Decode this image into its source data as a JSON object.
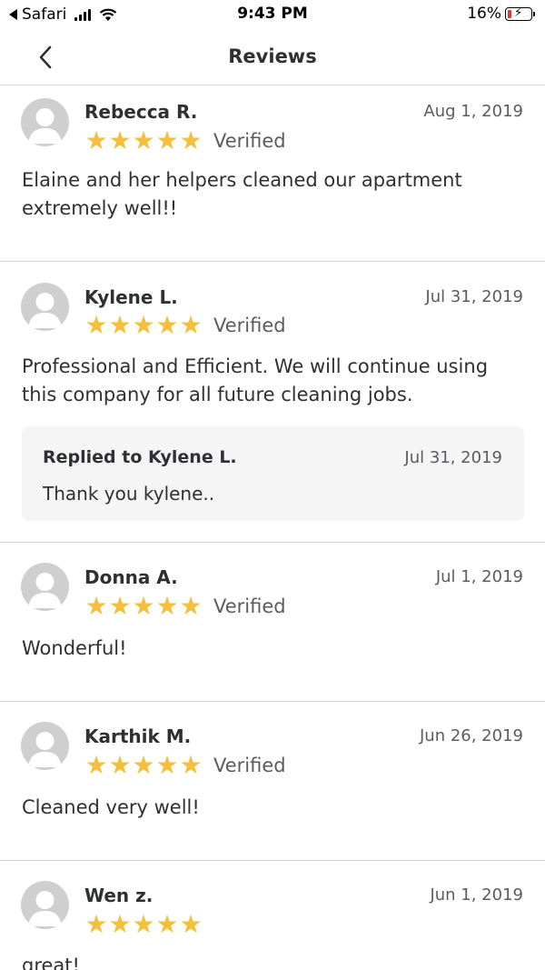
{
  "status_bar": {
    "back_app": "Safari",
    "time": "9:43 PM",
    "battery_percent": "16%",
    "battery_level": 0.16,
    "battery_color": "#e7343b"
  },
  "nav": {
    "title": "Reviews",
    "back_icon": "chevron-left-icon"
  },
  "colors": {
    "star": "#f4bf3b",
    "text": "#2f3033",
    "muted": "#5a5c60",
    "reply_bg": "#f5f5f6"
  },
  "reviews": [
    {
      "name": "Rebecca R.",
      "date": "Aug 1, 2019",
      "rating": 5,
      "verified": "Verified",
      "text_lines": [
        "Elaine and her helpers cleaned our apartment",
        "extremely well!!"
      ]
    },
    {
      "name": "Kylene L.",
      "date": "Jul 31, 2019",
      "rating": 5,
      "verified": "Verified",
      "text_lines": [
        "Professional and Efficient. We will continue using",
        "this company for all future cleaning jobs."
      ],
      "reply": {
        "title": "Replied to Kylene L.",
        "date": "Jul 31, 2019",
        "text": "Thank you kylene.."
      }
    },
    {
      "name": "Donna A.",
      "date": "Jul 1, 2019",
      "rating": 5,
      "verified": "Verified",
      "text_lines": [
        "Wonderful!"
      ]
    },
    {
      "name": "Karthik M.",
      "date": "Jun 26, 2019",
      "rating": 5,
      "verified": "Verified",
      "text_lines": [
        "Cleaned very well!"
      ]
    },
    {
      "name": "Wen z.",
      "date": "Jun 1, 2019",
      "rating": 5,
      "verified": "",
      "text_lines": [
        "great!"
      ]
    }
  ]
}
